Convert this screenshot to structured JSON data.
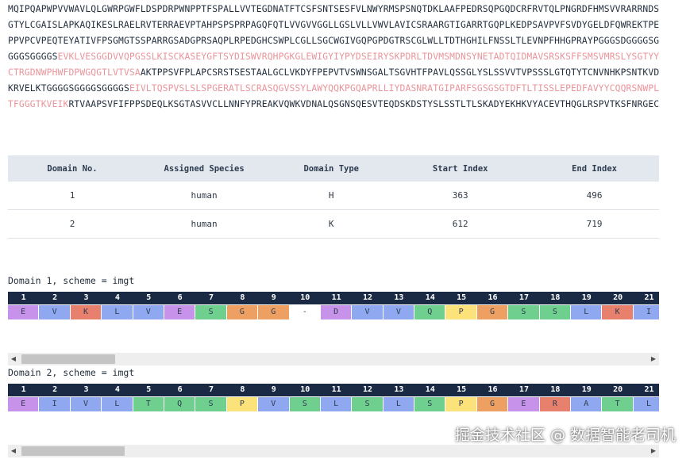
{
  "sequence": {
    "part1": "MQIPQAPWPVVWAVLQLGWRPGWFLDSPDRPWNPPTFSPALLVVTEGDNATFTCSFSNTSESFVLNWYRMSPSNQTDKLAAFPEDRSQPGQDCRFRVTQLPNGRDFHMSVVRARRNDSGTYLCGAISLAPKAQIKESLRAELRVTERRAEVPTAHPSPSPRPAGQFQTLVVGVVGGLLGSLVLLVWVLAVICSRAARGTIGARRTGQPLKEDPSAVPVFSVDYGELDFQWREKTPEPPVPCVPEQTEYATIVFPSGMGTSSPARRGSADGPRSAQPLRPEDGHCSWPLCGLLSGCWGIVGQPGPDGTRSCGLWLLTDTHGHILFNSSLTLEVNPFHHGPRAYPGGGSDGGGGSGGGGSGGGGS",
    "domain1": "EVKLVESGGDVVQPGSSLKISCKASEYGFTSYDISWVRQHPGKGLEWIGYIYPYDSEIRYSKPDRLTDVMSMDNSYNETADTQIDMAVSRSKSFFSMSVMRSLYSGTYYCTRGDNWPHWFDPWGQGTLVTVSA",
    "part2": "AKTPPSVFPLAPCSRSTSESTAALGCLVKDYFPEPVTVSWNSGALTSGVHTFPAVLQSSGLYSLSSVVTVPSSSLGTQTYTCNVNHKPSNTKVDKRVELKTGGGGSGGGGSGGGGS",
    "domain2": "EIVLTQSPVSLSLSPGERATLSCRASQGVSSYLAWYQQKPGQAPRLLIYDASNRATGIPARFSGSGSGTDFTLTISSLEPEDFAVYYCQQRSNWPLTFGGGTKVEIK",
    "part3": "RTVAAPSVFIFPPSDEQLKSGTASVVCLLNNFYPREAKVQWKVDNALQSGNSQESVTEQDSKDSTYSLSSTLTLSKADYEKHKVYACEVTHQGLRSPVTKSFNRGEC"
  },
  "table": {
    "headers": [
      "Domain No.",
      "Assigned Species",
      "Domain Type",
      "Start Index",
      "End Index"
    ],
    "rows": [
      [
        "1",
        "human",
        "H",
        "363",
        "496"
      ],
      [
        "2",
        "human",
        "K",
        "612",
        "719"
      ]
    ]
  },
  "domains": [
    {
      "label": "Domain 1, scheme = imgt",
      "positions": [
        "1",
        "2",
        "3",
        "4",
        "5",
        "6",
        "7",
        "8",
        "9",
        "10",
        "11",
        "12",
        "13",
        "14",
        "15",
        "16",
        "17",
        "18",
        "19",
        "20",
        "21"
      ],
      "residues": [
        "E",
        "V",
        "K",
        "L",
        "V",
        "E",
        "S",
        "G",
        "G",
        "-",
        "D",
        "V",
        "V",
        "Q",
        "P",
        "G",
        "S",
        "S",
        "L",
        "K",
        "I"
      ]
    },
    {
      "label": "Domain 2, scheme = imgt",
      "positions": [
        "1",
        "2",
        "3",
        "4",
        "5",
        "6",
        "7",
        "8",
        "9",
        "10",
        "11",
        "12",
        "13",
        "14",
        "15",
        "16",
        "17",
        "18",
        "19",
        "20",
        "21"
      ],
      "residues": [
        "E",
        "I",
        "V",
        "L",
        "T",
        "Q",
        "S",
        "P",
        "V",
        "S",
        "L",
        "S",
        "L",
        "S",
        "P",
        "G",
        "E",
        "R",
        "A",
        "T",
        "L"
      ]
    }
  ],
  "residue_colors": {
    "E": "#c792ea",
    "D": "#c792ea",
    "K": "#e8806e",
    "R": "#e8806e",
    "V": "#8fa8f0",
    "L": "#8fa8f0",
    "I": "#8fa8f0",
    "Q": "#6fcf8f",
    "S": "#6fcf8f",
    "T": "#6fcf8f",
    "G": "#eea062",
    "P": "#fbe27a",
    "A": "#8fa8f0",
    "-": "#ffffff"
  },
  "scrollbar_icons": {
    "left": "scroll-left-arrow-icon",
    "right": "scroll-right-arrow-icon"
  },
  "scrollbar_glyphs": {
    "left": "◀",
    "right": "▶"
  },
  "watermark": "掘金技术社区 @ 数据智能老司机"
}
